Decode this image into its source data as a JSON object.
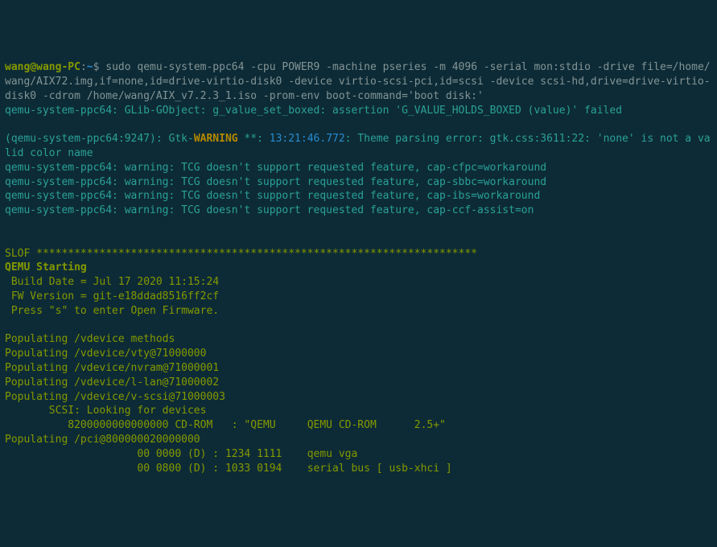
{
  "prompt": {
    "user": "wang",
    "host": "wang-PC",
    "path": "~",
    "sigil": "$",
    "command": "sudo qemu-system-ppc64 -cpu POWER9 -machine pseries -m 4096 -serial mon:stdio -drive file=/home/wang/AIX72.img,if=none,id=drive-virtio-disk0 -device virtio-scsi-pci,id=scsi -device scsi-hd,drive=drive-virtio-disk0 -cdrom /home/wang/AIX_v7.2.3_1.iso -prom-env boot-command='boot disk:'"
  },
  "glib_error": "qemu-system-ppc64: GLib-GObject: g_value_set_boxed: assertion 'G_VALUE_HOLDS_BOXED (value)' failed",
  "gtk": {
    "prefix": "(qemu-system-ppc64:9247): Gtk-",
    "label": "WARNING",
    "stars": " **: ",
    "time": "13:21:46.772",
    "rest": ": Theme parsing error: gtk.css:3611:22: 'none' is not a valid color name"
  },
  "tcg": [
    "qemu-system-ppc64: warning: TCG doesn't support requested feature, cap-cfpc=workaround",
    "qemu-system-ppc64: warning: TCG doesn't support requested feature, cap-sbbc=workaround",
    "qemu-system-ppc64: warning: TCG doesn't support requested feature, cap-ibs=workaround",
    "qemu-system-ppc64: warning: TCG doesn't support requested feature, cap-ccf-assist=on"
  ],
  "slof": {
    "header": "SLOF **********************************************************************",
    "title": "QEMU Starting",
    "build_date": " Build Date = Jul 17 2020 11:15:24",
    "fw_version": " FW Version = git-e18ddad8516ff2cf",
    "press_s": " Press \"s\" to enter Open Firmware.",
    "lines": [
      "Populating /vdevice methods",
      "Populating /vdevice/vty@71000000",
      "Populating /vdevice/nvram@71000001",
      "Populating /vdevice/l-lan@71000002",
      "Populating /vdevice/v-scsi@71000003",
      "       SCSI: Looking for devices",
      "          8200000000000000 CD-ROM   : \"QEMU     QEMU CD-ROM      2.5+\"",
      "Populating /pci@800000020000000",
      "                     00 0000 (D) : 1234 1111    qemu vga",
      "                     00 0800 (D) : 1033 0194    serial bus [ usb-xhci ]"
    ]
  }
}
